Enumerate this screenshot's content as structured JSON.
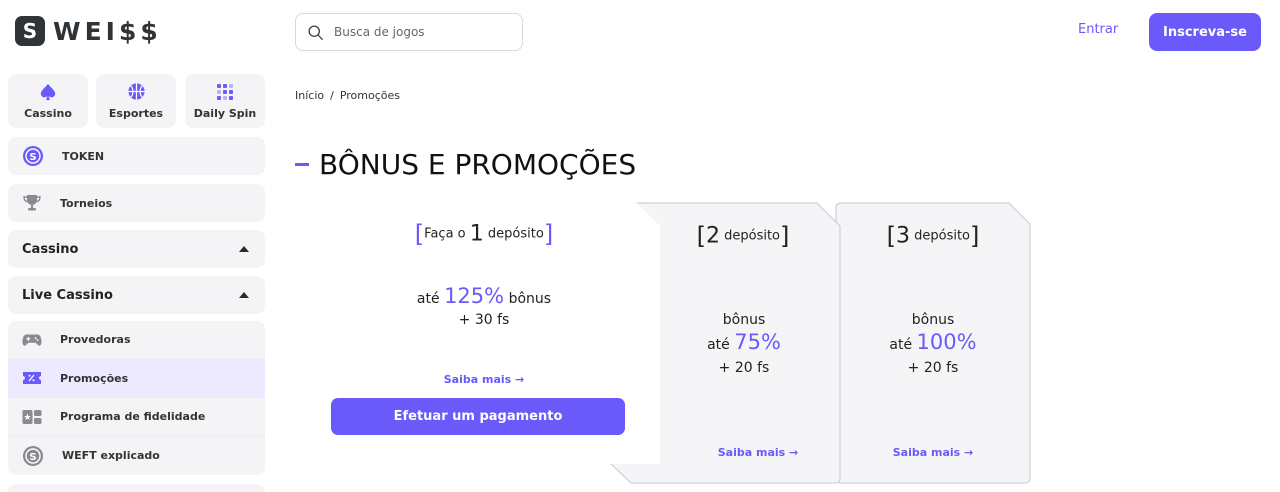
{
  "header": {
    "logo_letter": "S",
    "logo_text": "WEI$$",
    "search_placeholder": "Busca de jogos",
    "login_label": "Entrar",
    "signup_label": "Inscreva-se"
  },
  "sidebar": {
    "tiles": [
      {
        "label": "Cassino",
        "icon": "spade-icon"
      },
      {
        "label": "Esportes",
        "icon": "basketball-icon"
      },
      {
        "label": "Daily Spin",
        "icon": "grid-icon"
      }
    ],
    "token_label": "TOKEN",
    "torneios_label": "Torneios",
    "cassino_label": "Cassino",
    "live_label": "Live Cassino",
    "submenu": [
      {
        "label": "Provedoras",
        "icon": "gamepad-icon"
      },
      {
        "label": "Promoções",
        "icon": "coupon-icon"
      },
      {
        "label": "Programa de fidelidade",
        "icon": "loyalty-icon"
      },
      {
        "label": "WEFT explicado",
        "icon": "coin-icon"
      }
    ]
  },
  "breadcrumb": {
    "home": "Início",
    "sep": "/",
    "current": "Promoções"
  },
  "page_title": "BÔNUS E PROMOÇÕES",
  "cards": [
    {
      "open": "[",
      "prefix": "Faça o",
      "num": "1",
      "word": "depósito",
      "close": "]",
      "ate": "até",
      "pct": "125%",
      "bonus": "bônus",
      "fs": "+ 30 fs",
      "saiba": "Saiba mais →",
      "button": "Efetuar um pagamento"
    },
    {
      "open": "[",
      "num": "2",
      "word": "depósito",
      "close": "]",
      "bonus": "bônus",
      "ate": "até",
      "pct": "75%",
      "fs": "+ 20 fs",
      "saiba": "Saiba mais →"
    },
    {
      "open": "[",
      "num": "3",
      "word": "depósito",
      "close": "]",
      "bonus": "bônus",
      "ate": "até",
      "pct": "100%",
      "fs": "+ 20 fs",
      "saiba": "Saiba mais →"
    }
  ],
  "colors": {
    "accent": "#6a5af9",
    "surface": "#f4f4f6",
    "dark": "#2f3438"
  }
}
